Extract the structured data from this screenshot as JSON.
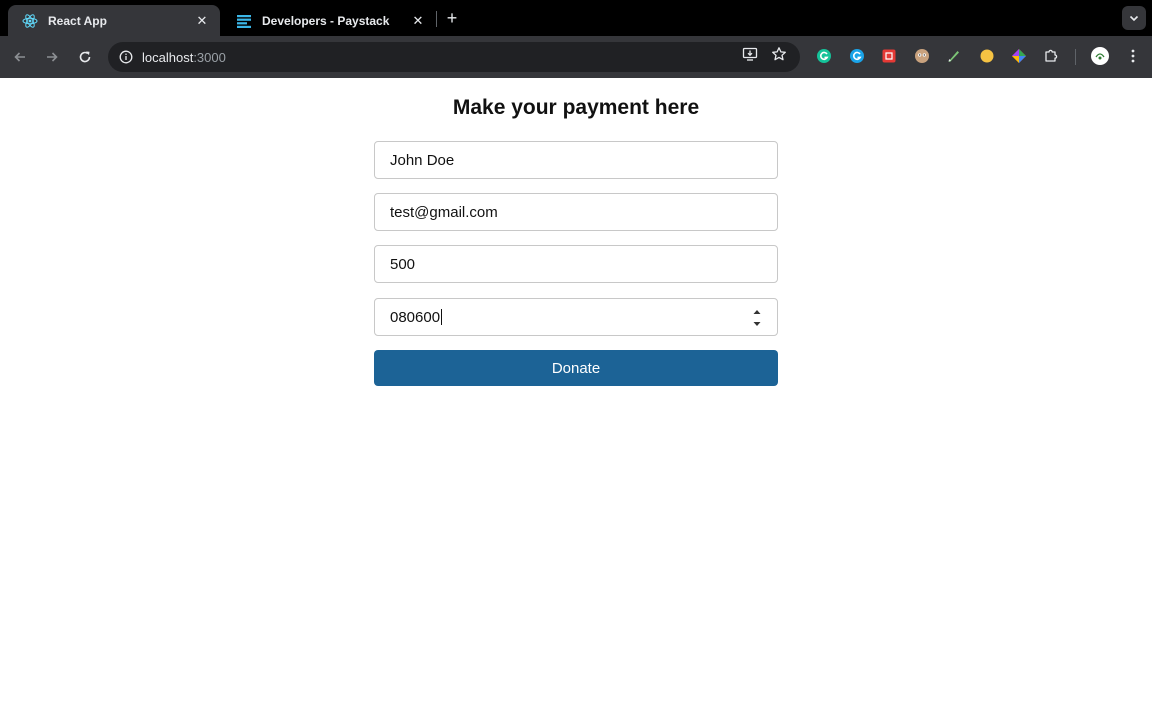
{
  "browser": {
    "tabs": [
      {
        "title": "React App",
        "active": true
      },
      {
        "title": "Developers - Paystack",
        "active": false
      }
    ],
    "address": {
      "host": "localhost",
      "port": ":3000"
    },
    "icons": [
      "back-arrow-icon",
      "forward-arrow-icon",
      "reload-icon",
      "site-info-icon",
      "install-app-icon",
      "bookmark-star-icon",
      "extensions-puzzle-icon",
      "profile-avatar-icon",
      "menu-kebab-icon"
    ],
    "colors": {
      "tabstrip": "#000000",
      "toolbar": "#35363a",
      "omnibox": "#202124"
    }
  },
  "form": {
    "heading": "Make your payment here",
    "name_value": "John Doe",
    "email_value": "test@gmail.com",
    "amount_value": "500",
    "phone_value": "080600",
    "submit_label": "Donate",
    "submit_color": "#1c6396"
  }
}
